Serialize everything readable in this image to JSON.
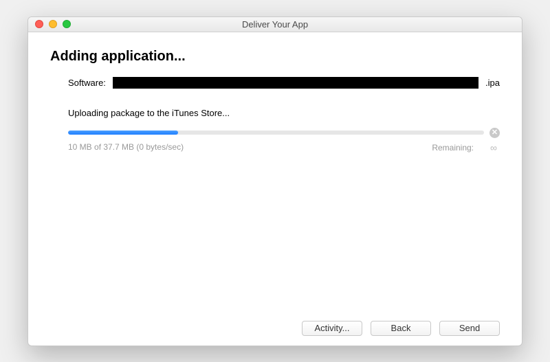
{
  "window": {
    "title": "Deliver Your App"
  },
  "heading": "Adding application...",
  "software": {
    "label": "Software:",
    "extension": ".ipa"
  },
  "status": "Uploading package to the iTunes Store...",
  "progress": {
    "percent": 26.5,
    "text": "10 MB of 37.7 MB (0 bytes/sec)",
    "remaining_label": "Remaining:",
    "remaining_value": "∞"
  },
  "buttons": {
    "activity": "Activity...",
    "back": "Back",
    "send": "Send"
  }
}
